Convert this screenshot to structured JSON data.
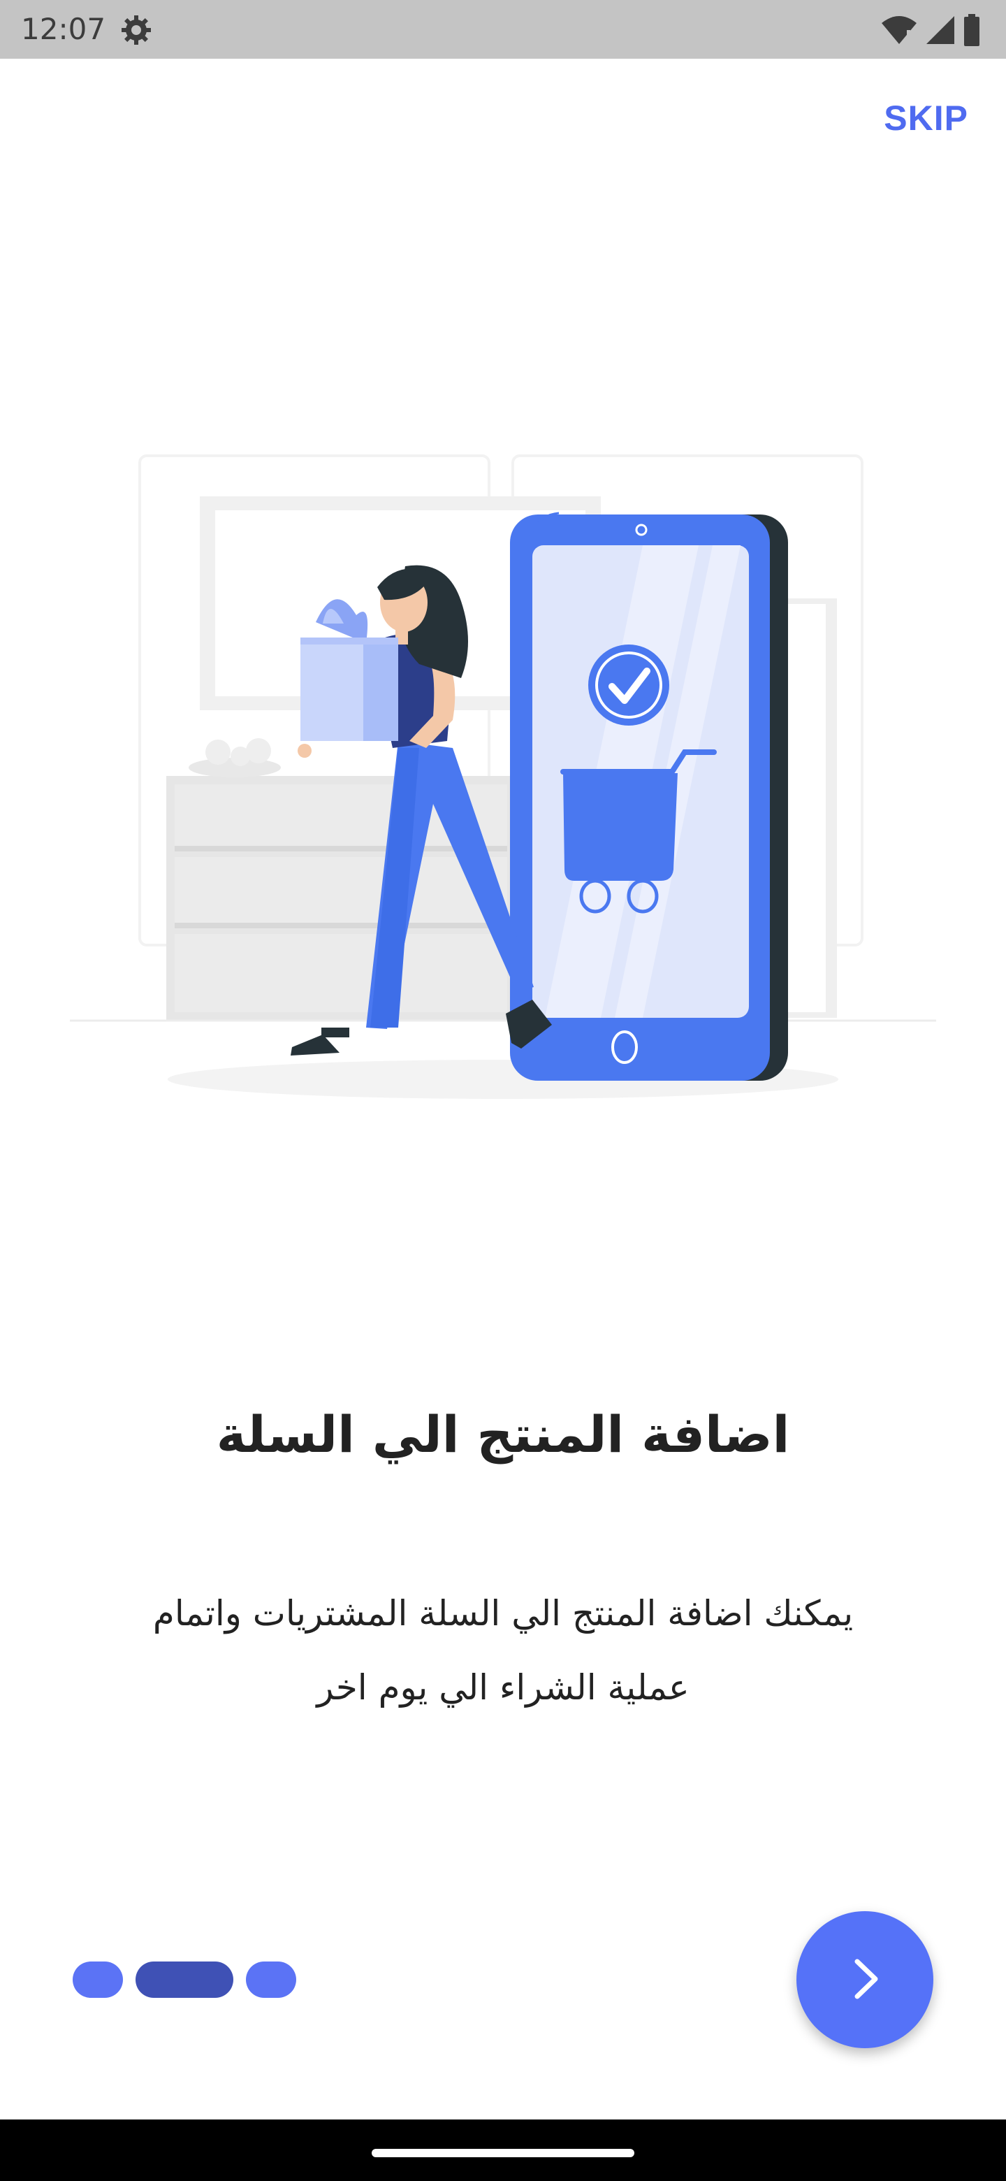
{
  "status_bar": {
    "time": "12:07",
    "icons": [
      "settings-icon",
      "wifi-icon",
      "signal-icon",
      "battery-icon"
    ]
  },
  "header": {
    "skip_label": "SKIP"
  },
  "illustration": {
    "icon": "woman-with-shopping-bag-and-phone-cart-illustration"
  },
  "content": {
    "title": "اضافة المنتج الي السلة",
    "description_line1": "يمكنك اضافة المنتج الي السلة المشتريات واتمام",
    "description_line2": "عملية الشراء الي يوم اخر"
  },
  "pager": {
    "total_pages": 3,
    "current_page": 2
  },
  "next_button": {
    "icon": "chevron-right-icon"
  },
  "colors": {
    "accent": "#5572f8",
    "active_dot": "#3f51b5",
    "dot": "#5b73f5",
    "skip": "#4f6bf0"
  }
}
